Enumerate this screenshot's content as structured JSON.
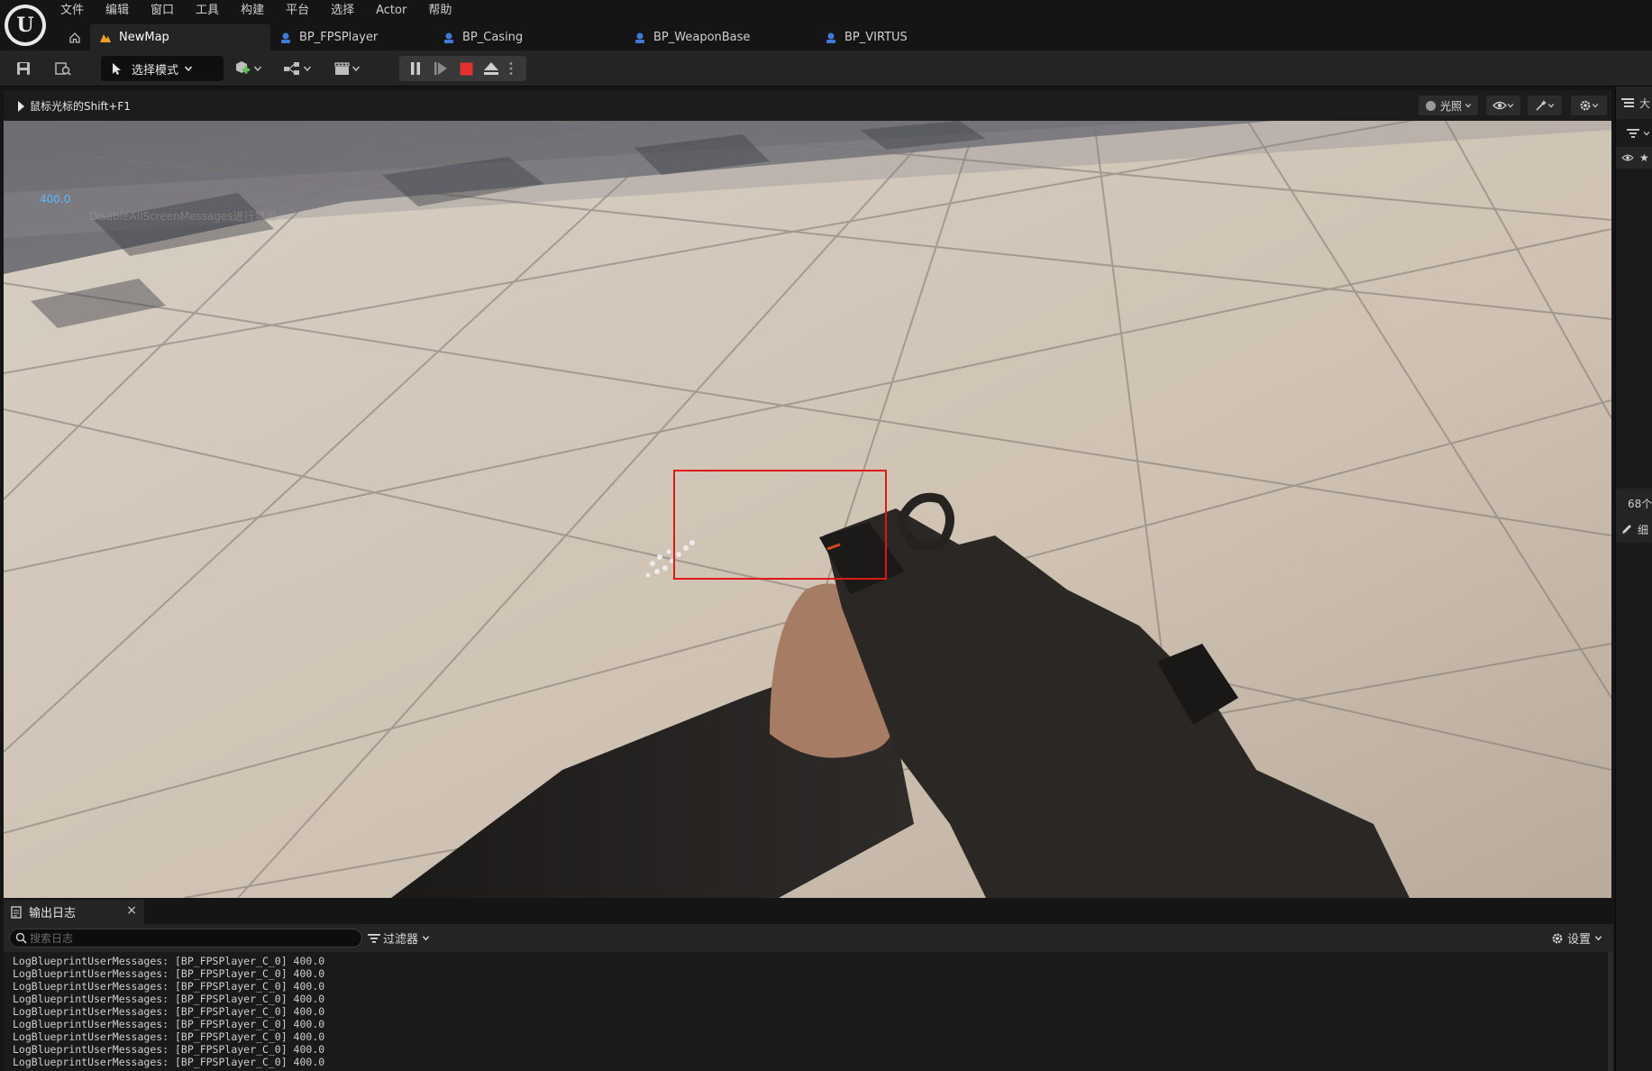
{
  "app": {
    "menu": [
      "文件",
      "编辑",
      "窗口",
      "工具",
      "构建",
      "平台",
      "选择",
      "Actor",
      "帮助"
    ],
    "tabs": [
      {
        "label": "NewMap",
        "active": true
      },
      {
        "label": "BP_FPSPlayer",
        "active": false
      },
      {
        "label": "BP_Casing",
        "active": false
      },
      {
        "label": "BP_WeaponBase",
        "active": false
      },
      {
        "label": "BP_VIRTUS",
        "active": false
      }
    ]
  },
  "toolbar": {
    "mode_label": "选择模式"
  },
  "viewport": {
    "hint": "鼠标光标的Shift+F1",
    "lighting_label": "光照",
    "debug_value": "400.0",
    "debug_hint": "DisableAllScreenMessages进行禁用"
  },
  "right_panel": {
    "top_label": "大",
    "count_label": "68个",
    "details_label": "细"
  },
  "output_log": {
    "tab_label": "输出日志",
    "close_glyph": "×",
    "search_placeholder": "搜索日志",
    "filter_label": "过滤器",
    "settings_label": "设置",
    "lines": [
      "LogBlueprintUserMessages: [BP_FPSPlayer_C_0] 400.0",
      "LogBlueprintUserMessages: [BP_FPSPlayer_C_0] 400.0",
      "LogBlueprintUserMessages: [BP_FPSPlayer_C_0] 400.0",
      "LogBlueprintUserMessages: [BP_FPSPlayer_C_0] 400.0",
      "LogBlueprintUserMessages: [BP_FPSPlayer_C_0] 400.0",
      "LogBlueprintUserMessages: [BP_FPSPlayer_C_0] 400.0",
      "LogBlueprintUserMessages: [BP_FPSPlayer_C_0] 400.0",
      "LogBlueprintUserMessages: [BP_FPSPlayer_C_0] 400.0",
      "LogBlueprintUserMessages: [BP_FPSPlayer_C_0] 400.0"
    ]
  },
  "icons": {
    "logo": "unreal-logo-icon",
    "home": "home-icon",
    "save": "save-icon",
    "content_browser": "content-browser-icon",
    "mode": "select-mode-icon",
    "add_actor": "add-actor-icon",
    "blueprint": "blueprint-icon",
    "cinematics": "clapper-icon",
    "pause": "pause-icon",
    "step": "step-frame-icon",
    "stop": "stop-icon",
    "eject": "eject-icon",
    "more": "more-vertical-icon"
  },
  "colors": {
    "accent_blue": "#58b9ff",
    "stop_red": "#e53030",
    "highlight_red": "#e01818",
    "map_tab_icon": "#f0a020",
    "blueprint_tab_icon": "#3f7ad6"
  }
}
